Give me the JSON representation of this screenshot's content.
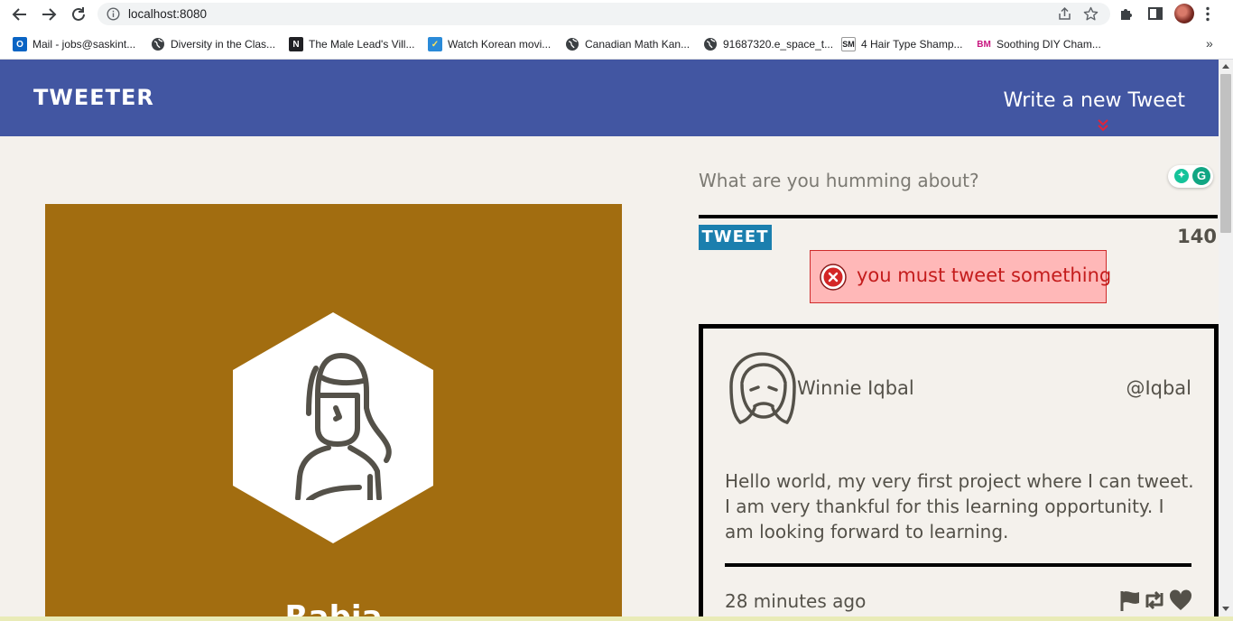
{
  "browser": {
    "url": "localhost:8080",
    "bookmarks": [
      {
        "label": "Mail - jobs@saskint...",
        "icon": "outlook-icon",
        "color": "#0a64c4"
      },
      {
        "label": "Diversity in the Clas...",
        "icon": "globe-icon",
        "color": "#3c4043"
      },
      {
        "label": "The Male Lead's Vill...",
        "icon": "novel-icon",
        "color": "#202124"
      },
      {
        "label": "Watch Korean movi...",
        "icon": "check-icon",
        "color": "#2a8ad8"
      },
      {
        "label": "Canadian Math Kan...",
        "icon": "globe-icon",
        "color": "#3c4043"
      },
      {
        "label": "91687320.e_space_t...",
        "icon": "globe-icon",
        "color": "#3c4043"
      },
      {
        "label": "4 Hair Type Shamp...",
        "icon": "sm-icon",
        "color": "#202124"
      },
      {
        "label": "Soothing DIY Cham...",
        "icon": "bm-icon",
        "color": "#c8157f"
      }
    ],
    "more_label": "»"
  },
  "header": {
    "logo": "TWEETER",
    "write_link": "Write a new Tweet",
    "background": "#4256a2",
    "chevron_color": "#e0243a"
  },
  "profile": {
    "name": "Rabia",
    "card_color": "#a26d10"
  },
  "compose": {
    "placeholder": "What are you humming about?",
    "button_label": "TWEET",
    "counter": "140",
    "error_message": "you must tweet something"
  },
  "tweet": {
    "name": "Winnie Iqbal",
    "handle": "@Iqbal",
    "body": "Hello world, my very first project where I can tweet. I am very thankful for this learning opportunity. I am looking forward to learning.",
    "time": "28 minutes ago",
    "actions": [
      "flag-icon",
      "retweet-icon",
      "heart-icon"
    ]
  },
  "colors": {
    "text": "#545149",
    "page_bg": "#f4f1ec",
    "tweet_button": "#1b7fae",
    "error_bg": "#ffb8b8",
    "error_text": "#c41c1c"
  }
}
